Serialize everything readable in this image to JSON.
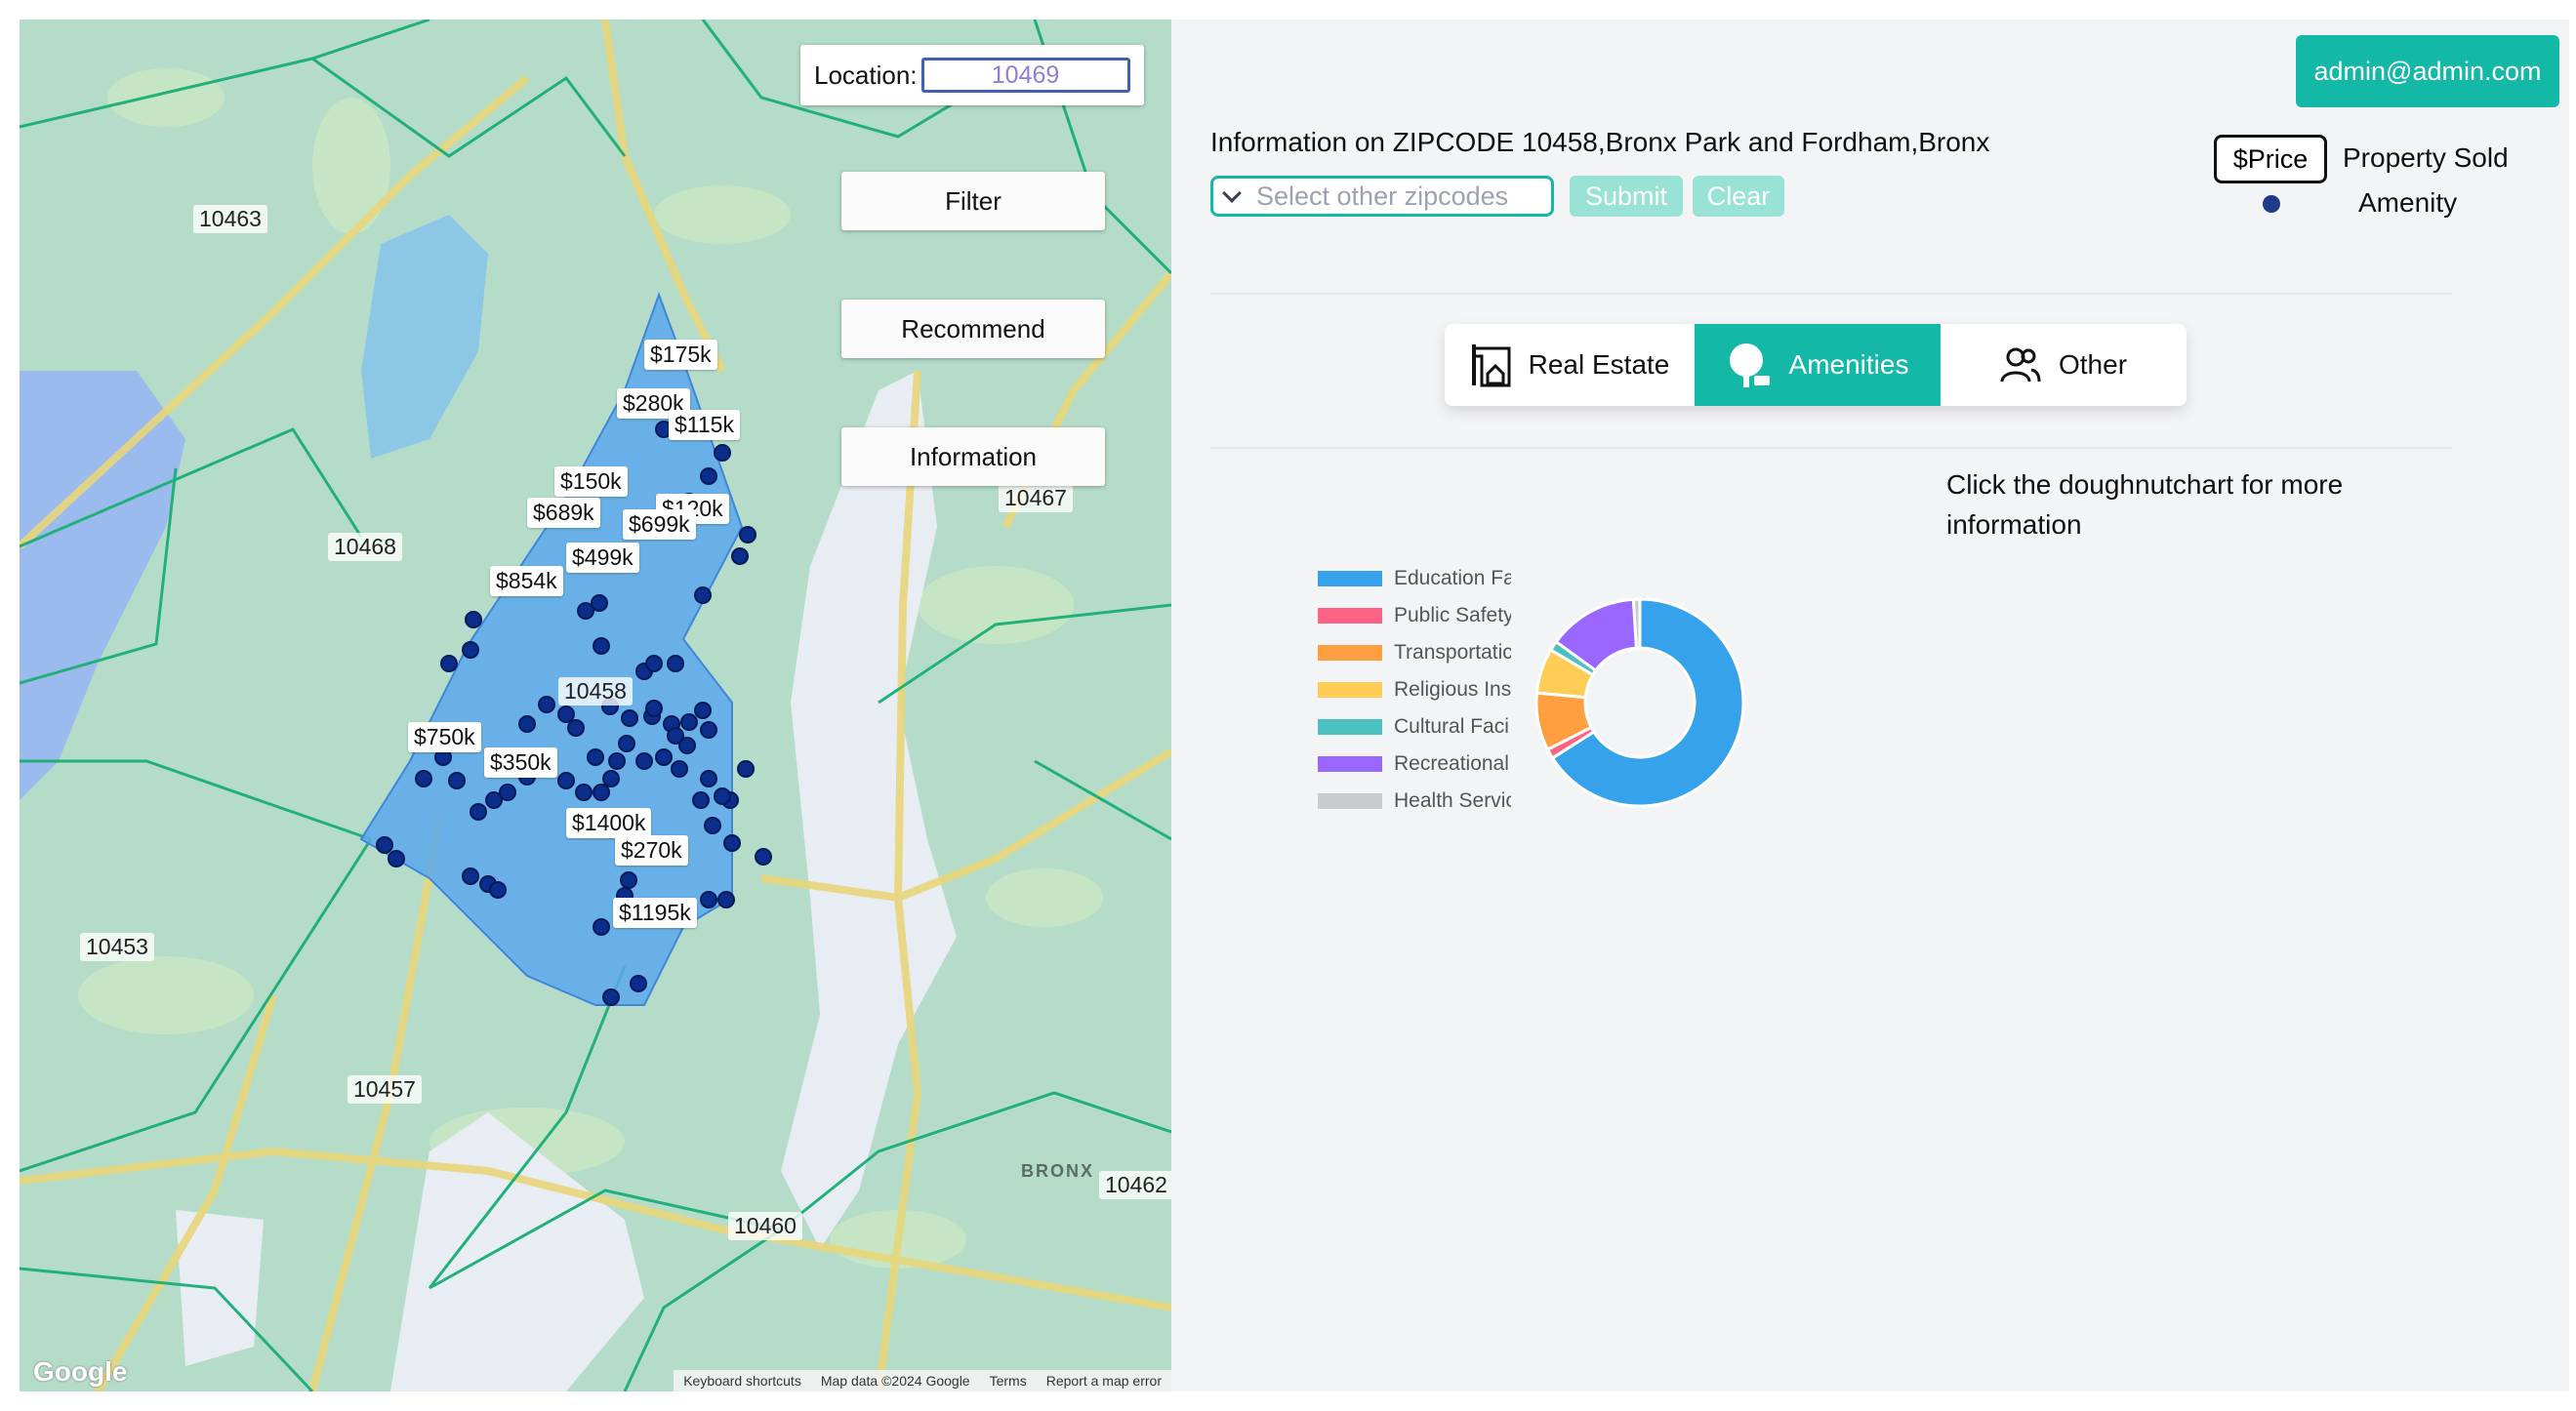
{
  "map": {
    "location_label": "Location:",
    "location_value": "10469",
    "buttons": {
      "filter": "Filter",
      "recommend": "Recommend",
      "information": "Information"
    },
    "zip_labels": [
      "10463",
      "10468",
      "10467",
      "10458",
      "10453",
      "10457",
      "10460",
      "10462"
    ],
    "area_label": "BRONX",
    "price_tags": [
      "$175k",
      "$280k",
      "$115k",
      "$150k",
      "$120k",
      "$689k",
      "$699k",
      "$499k",
      "$854k",
      "$750k",
      "$350k",
      "$1400k",
      "$270k",
      "$1195k"
    ],
    "google_logo": "Google",
    "footer": {
      "shortcuts": "Keyboard shortcuts",
      "map_data": "Map data ©2024 Google",
      "terms": "Terms",
      "report": "Report a map error"
    }
  },
  "header": {
    "user_email": "admin@admin.com",
    "info_title": "Information on ZIPCODE 10458,Bronx Park and Fordham,Bronx",
    "zip_select_placeholder": "Select other zipcodes",
    "submit_label": "Submit",
    "clear_label": "Clear"
  },
  "legend": {
    "price_box": "$Price",
    "price_text": "Property Sold",
    "amenity_text": "Amenity"
  },
  "tabs": [
    {
      "label": "Real Estate",
      "icon": "real-estate-icon",
      "active": false
    },
    {
      "label": "Amenities",
      "icon": "tree-icon",
      "active": true
    },
    {
      "label": "Other",
      "icon": "users-icon",
      "active": false
    }
  ],
  "chart_hint": "Click the doughnutchart for more information",
  "colors": {
    "accent": "#14b8a6",
    "polygon": "#5ba8ec",
    "amenity_dot": "#1e3a8a"
  },
  "chart_data": {
    "type": "doughnut",
    "legend_position": "left",
    "categories": [
      "Education Fa",
      "Public Safety",
      "Transportatic",
      "Religious Ins",
      "Cultural Faci",
      "Recreational",
      "Health Servic"
    ],
    "values": [
      66,
      1.5,
      9,
      7,
      1.5,
      14,
      1
    ],
    "colors": [
      "#36a2eb",
      "#ff6384",
      "#ff9f40",
      "#ffcd56",
      "#4bc0c0",
      "#9966ff",
      "#c9cbcf"
    ]
  }
}
